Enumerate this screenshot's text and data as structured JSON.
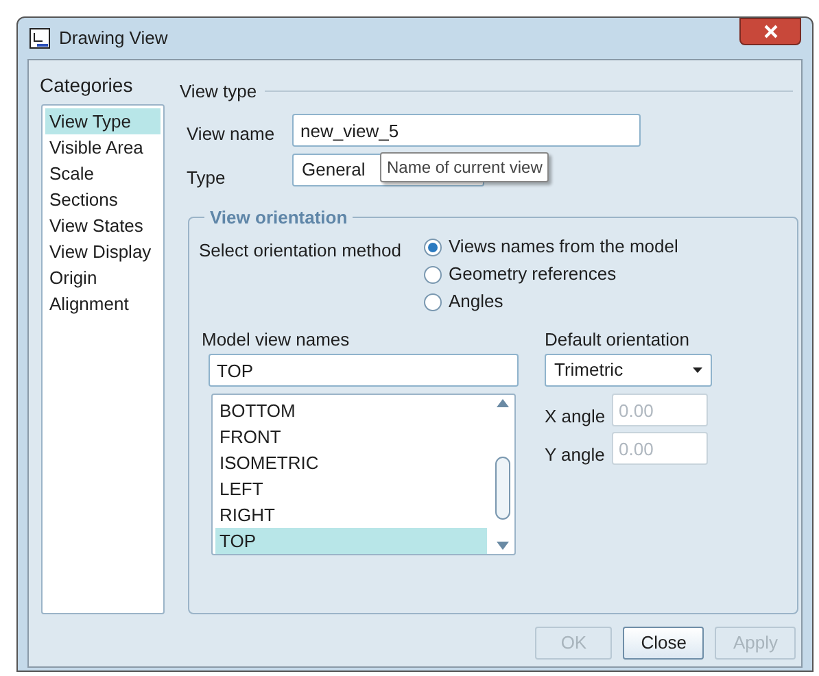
{
  "window": {
    "title": "Drawing View"
  },
  "categories": {
    "title": "Categories",
    "items": [
      {
        "label": "View Type",
        "selected": true
      },
      {
        "label": "Visible Area",
        "selected": false
      },
      {
        "label": "Scale",
        "selected": false
      },
      {
        "label": "Sections",
        "selected": false
      },
      {
        "label": "View States",
        "selected": false
      },
      {
        "label": "View Display",
        "selected": false
      },
      {
        "label": "Origin",
        "selected": false
      },
      {
        "label": "Alignment",
        "selected": false
      }
    ]
  },
  "view_type": {
    "title": "View type",
    "view_name_label": "View name",
    "view_name_value": "new_view_5",
    "type_label": "Type",
    "type_value": "General",
    "tooltip": "Name of current view"
  },
  "view_orientation": {
    "title": "View orientation",
    "method_label": "Select orientation method",
    "methods": [
      {
        "label": "Views names from the model",
        "selected": true
      },
      {
        "label": "Geometry references",
        "selected": false
      },
      {
        "label": "Angles",
        "selected": false
      }
    ],
    "model_view_names_label": "Model view names",
    "model_view_value": "TOP",
    "model_views": [
      {
        "label": "BOTTOM",
        "selected": false
      },
      {
        "label": "FRONT",
        "selected": false
      },
      {
        "label": "ISOMETRIC",
        "selected": false
      },
      {
        "label": "LEFT",
        "selected": false
      },
      {
        "label": "RIGHT",
        "selected": false
      },
      {
        "label": "TOP",
        "selected": true
      }
    ],
    "default_orientation_label": "Default orientation",
    "default_orientation_value": "Trimetric",
    "x_angle_label": "X angle",
    "x_angle_placeholder": "0.00",
    "y_angle_label": "Y angle",
    "y_angle_placeholder": "0.00"
  },
  "buttons": [
    {
      "label": "OK",
      "disabled": true
    },
    {
      "label": "Close",
      "disabled": false
    },
    {
      "label": "Apply",
      "disabled": true
    }
  ]
}
